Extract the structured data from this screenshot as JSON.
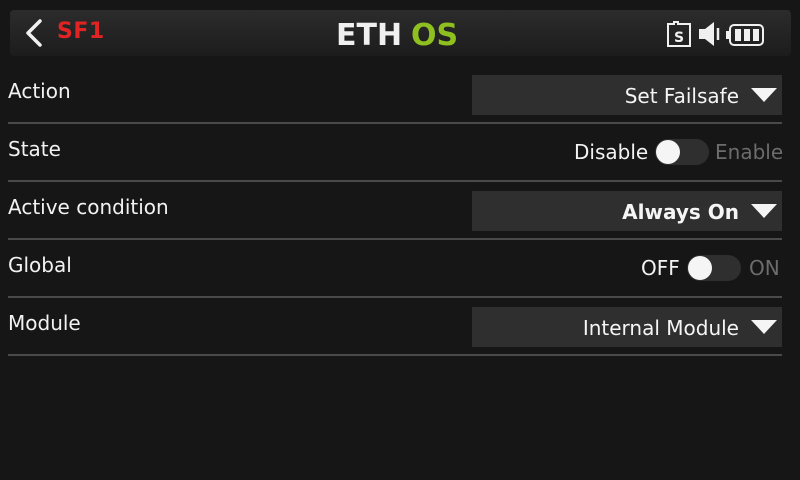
{
  "header": {
    "title": "SF1",
    "logo_text_white": "ETH",
    "logo_text_green": "OS",
    "back_icon": "chevron-left-icon",
    "status_icons": [
      "sd-card-icon",
      "volume-icon",
      "battery-icon"
    ],
    "sd_label": "S",
    "colors": {
      "title": "#e02424",
      "logo_green": "#8ec11f"
    }
  },
  "rows": {
    "action": {
      "label": "Action",
      "value": "Set Failsafe"
    },
    "state": {
      "label": "State",
      "off_label": "Disable",
      "on_label": "Enable",
      "enabled": false
    },
    "active_condition": {
      "label": "Active condition",
      "value": "Always On"
    },
    "global": {
      "label": "Global",
      "off_label": "OFF",
      "on_label": "ON",
      "enabled": false
    },
    "module": {
      "label": "Module",
      "value": "Internal Module"
    }
  }
}
